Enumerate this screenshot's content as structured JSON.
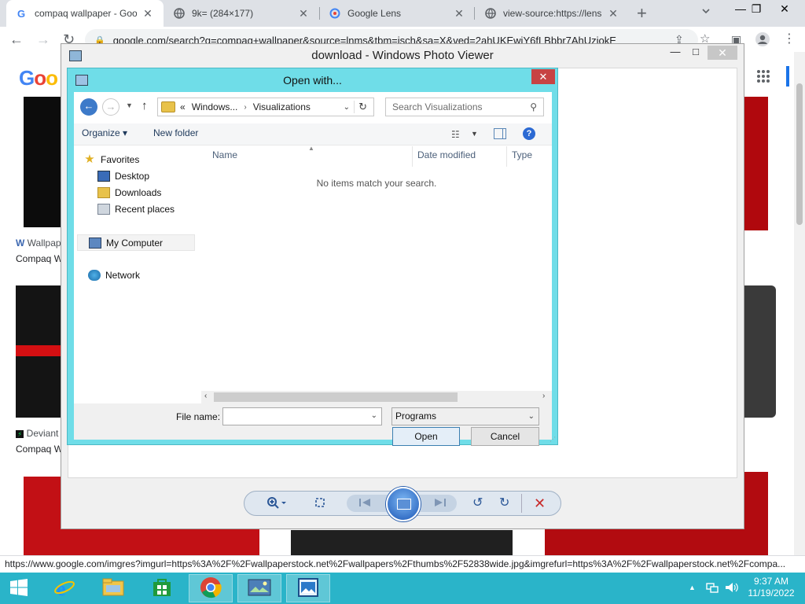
{
  "browser": {
    "tabs": [
      {
        "title": "compaq wallpaper - Goo",
        "close": "✕"
      },
      {
        "title": "9k= (284×177)",
        "close": "✕"
      },
      {
        "title": "Google Lens",
        "close": "✕"
      },
      {
        "title": "view-source:https://lens",
        "close": "✕"
      }
    ],
    "new_tab": "+",
    "url": "google.com/search?q=compaq+wallpaper&source=lnms&tbm=isch&sa=X&ved=2ahUKEwiY6fLBbbr7AhUziokE",
    "status_url": "https://www.google.com/imgres?imgurl=https%3A%2F%2Fwallpaperstock.net%2Fwallpapers%2Fthumbs%2F52838wide.jpg&imgrefurl=https%3A%2F%2Fwallpaperstock.net%2Fcompa...",
    "page": {
      "logo": "Goo",
      "results": [
        {
          "source": "Wallpap",
          "title": "Compaq W"
        },
        {
          "source": "Deviant",
          "title": "Compaq W"
        }
      ]
    }
  },
  "photo_viewer": {
    "title": "download - Windows Photo Viewer",
    "controls": {
      "minimize": "—",
      "maximize": "□",
      "close": "✕"
    }
  },
  "dialog": {
    "title": "Open with...",
    "close": "✕",
    "address": {
      "overflow": "«",
      "crumbs": [
        "Windows...",
        "Visualizations"
      ]
    },
    "search_placeholder": "Search Visualizations",
    "commands": {
      "organize": "Organize ▾",
      "new_folder": "New folder"
    },
    "nav": {
      "favorites": "Favorites",
      "desktop": "Desktop",
      "downloads": "Downloads",
      "recent": "Recent places",
      "computer": "My Computer",
      "network": "Network"
    },
    "columns": {
      "name": "Name",
      "date": "Date modified",
      "type": "Type"
    },
    "empty_message": "No items match your search.",
    "file_name_label": "File name:",
    "file_name_value": "",
    "file_type": "Programs",
    "open_button": "Open",
    "cancel_button": "Cancel"
  },
  "taskbar": {
    "clock_time": "9:37 AM",
    "clock_date": "11/19/2022"
  },
  "colors": {
    "dialog_frame": "#6fdde8",
    "taskbar": "#2ab4c9",
    "close_red": "#c74343",
    "accent_blue": "#1a73e8"
  }
}
